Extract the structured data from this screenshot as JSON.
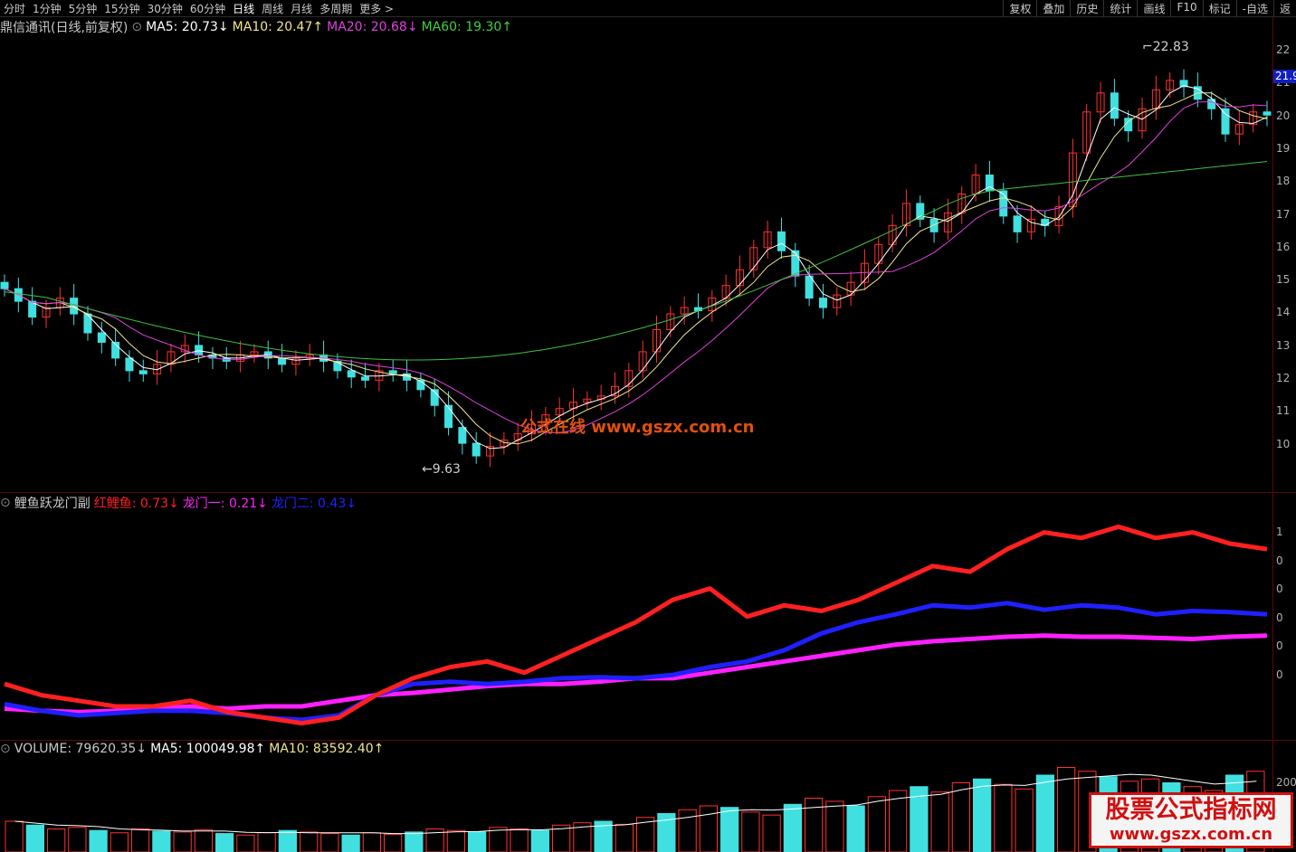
{
  "toolbar": {
    "periods": [
      "分时",
      "1分钟",
      "5分钟",
      "15分钟",
      "30分钟",
      "60分钟",
      "日线",
      "周线",
      "月线",
      "多周期",
      "更多 >"
    ],
    "active_period": "日线",
    "tools": [
      "复权",
      "叠加",
      "历史",
      "统计",
      "画线",
      "F10",
      "标记",
      "-自选",
      "返"
    ]
  },
  "main_legend": {
    "title": "鼎信通讯(日线,前复权)",
    "ma5": "MA5: 20.73↓",
    "ma10": "MA10: 20.47↑",
    "ma20": "MA20: 20.68↓",
    "ma60": "MA60: 19.30↑",
    "colors": {
      "ma5": "#ffffff",
      "ma10": "#f0e68c",
      "ma20": "#e040e0",
      "ma60": "#40d040"
    }
  },
  "main_axis": {
    "ticks": [
      "22",
      "21",
      "20",
      "19",
      "18",
      "17",
      "16",
      "15",
      "14",
      "13",
      "12",
      "11",
      "10"
    ],
    "current_price": "21.9"
  },
  "annotations": {
    "high": "22.83",
    "low": "9.63"
  },
  "watermark": {
    "text": "公式在线  www.gszx.com.cn"
  },
  "indicator_legend": {
    "title": "鲤鱼跃龙门副",
    "red": "红鲤鱼: 0.73↓",
    "magenta": "龙门一: 0.21↓",
    "blue": "龙门二: 0.43↓",
    "colors": {
      "red": "#ff2020",
      "magenta": "#ff20ff",
      "blue": "#2020ff"
    }
  },
  "indicator_axis": {
    "ticks": [
      "1",
      "0",
      "0",
      "0",
      "0",
      "0"
    ]
  },
  "volume_legend": {
    "title": "VOLUME: 79620.35↓",
    "ma5": "MA5: 100049.98↑",
    "ma10": "MA10: 83592.40↑"
  },
  "volume_axis": {
    "ticks": [
      "200"
    ]
  },
  "brand": {
    "line1": "股票公式指标网",
    "line2": "www.gszx.com.cn"
  },
  "chart_data": {
    "type": "candlestick",
    "price_range": [
      9.63,
      22.83
    ],
    "closes": [
      15.2,
      14.8,
      14.3,
      14.6,
      14.9,
      14.4,
      13.8,
      13.5,
      13.0,
      12.6,
      12.5,
      12.8,
      13.2,
      13.4,
      13.1,
      13.0,
      12.9,
      13.1,
      13.2,
      13.0,
      12.8,
      13.0,
      13.1,
      12.9,
      12.6,
      12.4,
      12.3,
      12.6,
      12.5,
      12.3,
      12.0,
      11.5,
      10.8,
      10.3,
      9.9,
      10.2,
      10.4,
      10.6,
      10.9,
      11.2,
      11.4,
      11.6,
      11.7,
      11.8,
      12.1,
      12.6,
      13.2,
      13.9,
      14.4,
      14.6,
      14.5,
      14.9,
      15.3,
      15.8,
      16.5,
      17.0,
      16.4,
      15.6,
      14.9,
      14.6,
      15.0,
      15.4,
      16.0,
      16.6,
      17.2,
      17.9,
      17.4,
      17.0,
      17.6,
      18.2,
      18.8,
      18.3,
      17.5,
      17.0,
      17.4,
      17.2,
      17.8,
      19.5,
      20.8,
      21.4,
      20.6,
      20.2,
      20.9,
      21.5,
      21.8,
      21.6,
      21.2,
      20.9,
      20.1,
      20.4,
      20.8,
      20.7
    ],
    "ma60_start": 15.1,
    "ma60_end": 19.3,
    "indicator": {
      "red": [
        0.0,
        -0.1,
        -0.15,
        -0.2,
        -0.2,
        -0.15,
        -0.25,
        -0.3,
        -0.35,
        -0.3,
        -0.1,
        0.05,
        0.15,
        0.2,
        0.1,
        0.25,
        0.4,
        0.55,
        0.75,
        0.85,
        0.6,
        0.7,
        0.65,
        0.75,
        0.9,
        1.05,
        1.0,
        1.2,
        1.35,
        1.3,
        1.4,
        1.3,
        1.35,
        1.25,
        1.2
      ],
      "magenta": [
        -0.22,
        -0.24,
        -0.25,
        -0.24,
        -0.22,
        -0.2,
        -0.22,
        -0.2,
        -0.2,
        -0.15,
        -0.1,
        -0.08,
        -0.05,
        -0.02,
        0.0,
        0.0,
        0.02,
        0.05,
        0.05,
        0.1,
        0.15,
        0.2,
        0.25,
        0.3,
        0.35,
        0.38,
        0.4,
        0.42,
        0.43,
        0.42,
        0.42,
        0.41,
        0.4,
        0.42,
        0.43
      ],
      "blue": [
        -0.18,
        -0.24,
        -0.28,
        -0.26,
        -0.24,
        -0.24,
        -0.26,
        -0.3,
        -0.32,
        -0.28,
        -0.1,
        0.0,
        0.02,
        0.0,
        0.02,
        0.05,
        0.06,
        0.05,
        0.08,
        0.15,
        0.2,
        0.3,
        0.45,
        0.55,
        0.62,
        0.7,
        0.68,
        0.72,
        0.66,
        0.7,
        0.68,
        0.62,
        0.65,
        0.64,
        0.62
      ]
    },
    "volume": [
      40,
      35,
      30,
      32,
      28,
      25,
      30,
      27,
      26,
      29,
      24,
      22,
      25,
      28,
      26,
      24,
      22,
      25,
      23,
      26,
      30,
      28,
      26,
      32,
      30,
      28,
      35,
      38,
      40,
      36,
      45,
      50,
      55,
      60,
      58,
      52,
      48,
      62,
      70,
      66,
      60,
      72,
      80,
      85,
      78,
      90,
      95,
      88,
      82,
      100,
      110,
      105,
      98,
      92,
      95,
      90,
      85,
      80,
      100,
      105
    ]
  }
}
